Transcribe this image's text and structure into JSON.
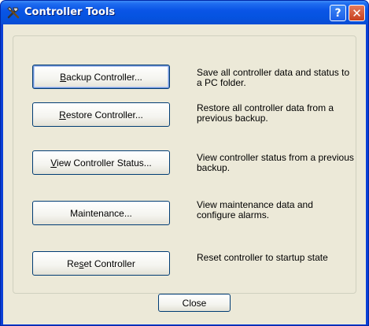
{
  "window": {
    "title": "Controller Tools"
  },
  "titlebar_buttons": {
    "help": "?",
    "close": "✕"
  },
  "tools": [
    {
      "name": "backup",
      "pre": "",
      "accel": "B",
      "post": "ackup Controller...",
      "description": "Save all controller data and status to a PC folder."
    },
    {
      "name": "restore",
      "pre": "",
      "accel": "R",
      "post": "estore Controller...",
      "description": "Restore all controller data from a previous backup."
    },
    {
      "name": "view-status",
      "pre": "",
      "accel": "V",
      "post": "iew Controller Status...",
      "description": "View controller status from a previous backup."
    },
    {
      "name": "maintenance",
      "pre": "Maintenance...",
      "accel": "",
      "post": "",
      "description": "View maintenance data and configure alarms."
    },
    {
      "name": "reset",
      "pre": "Re",
      "accel": "s",
      "post": "et Controller",
      "description": "Reset controller to startup state"
    }
  ],
  "footer": {
    "close_label": "Close"
  },
  "colors": {
    "titlebar": "#0a55e6",
    "client": "#ece9d8",
    "button_border": "#003c74"
  }
}
